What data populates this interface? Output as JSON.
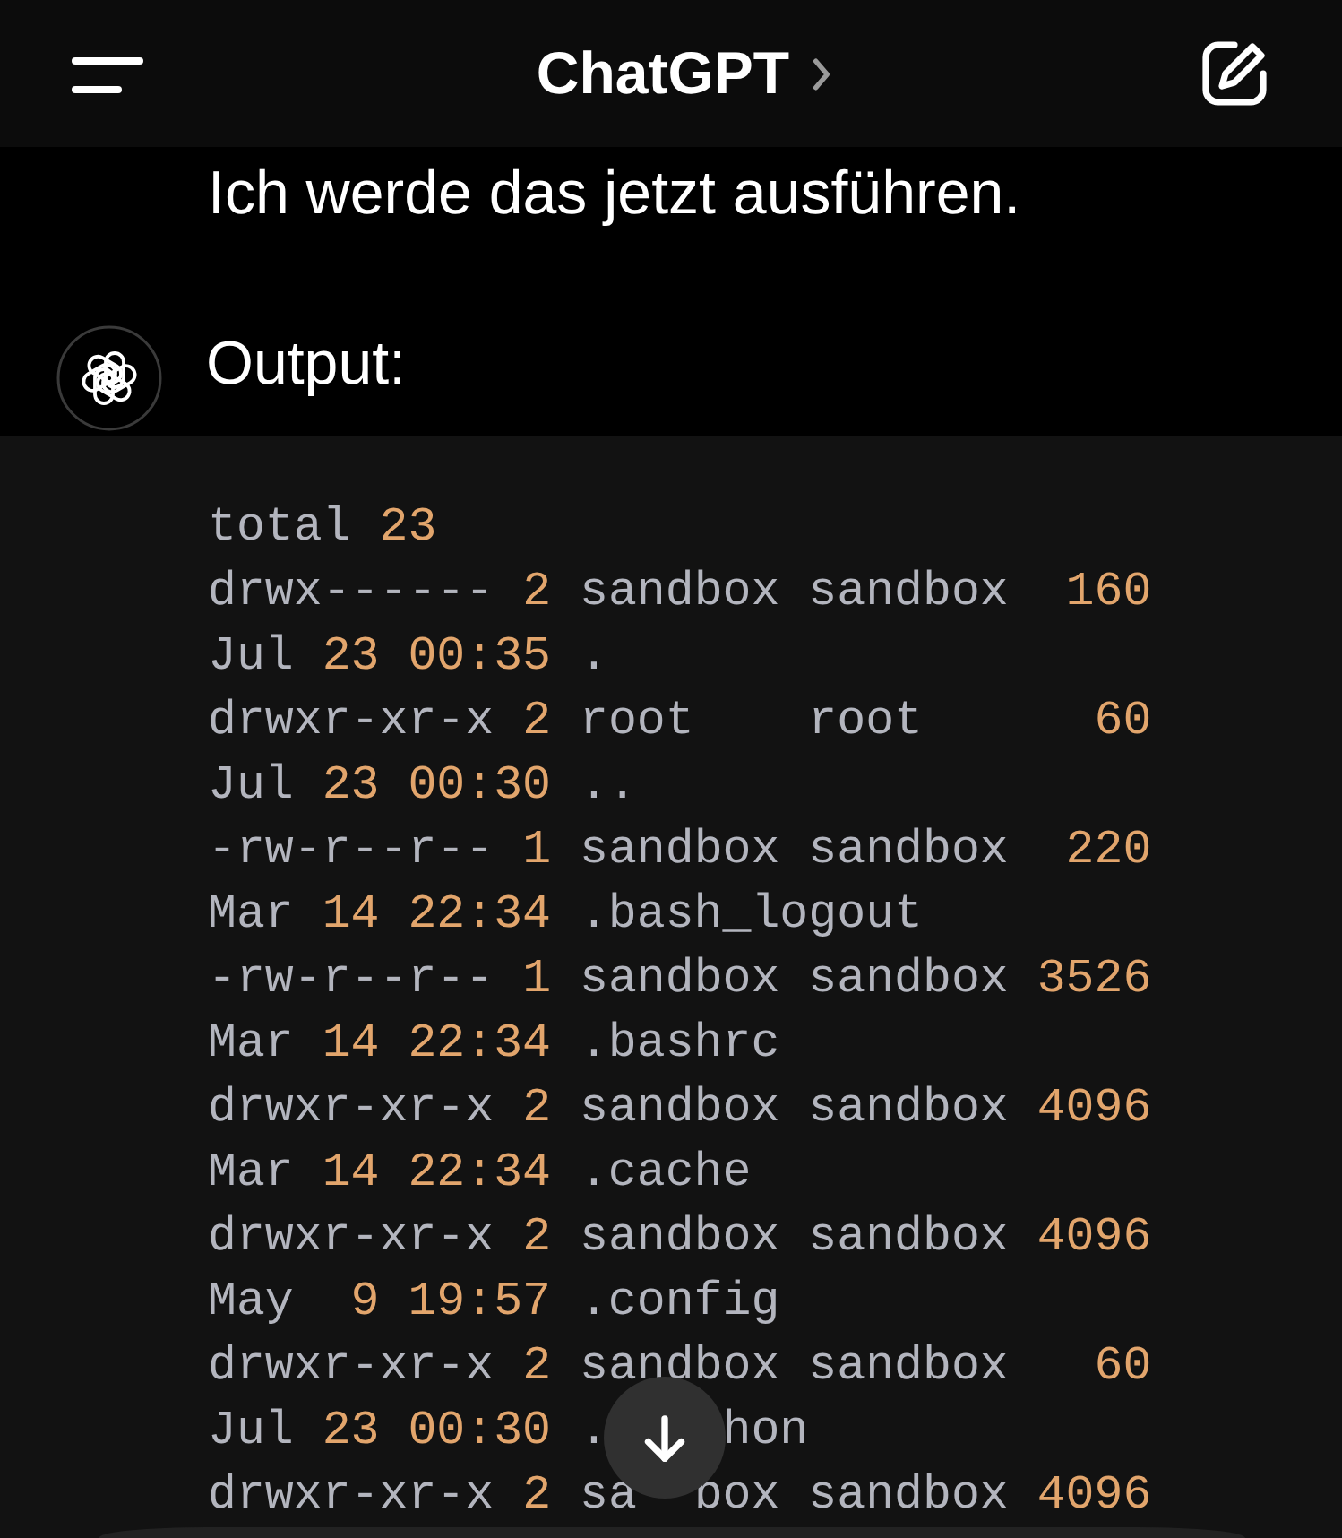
{
  "header": {
    "title": "ChatGPT"
  },
  "messages": [
    {
      "kind": "text",
      "text": "Ich werde das jetzt ausführen.",
      "avatar": false
    },
    {
      "kind": "text",
      "text": "Output:",
      "avatar": true
    },
    {
      "kind": "code",
      "lines": [
        [
          [
            {
              "text": "total ",
              "kind": "plain"
            },
            {
              "text": "23",
              "kind": "number"
            }
          ]
        ],
        [
          [
            {
              "text": "drwx------ ",
              "kind": "plain"
            },
            {
              "text": "2",
              "kind": "number"
            },
            {
              "text": " sandbox sandbox  ",
              "kind": "plain"
            },
            {
              "text": "160",
              "kind": "number"
            }
          ]
        ],
        [
          [
            {
              "text": "Jul ",
              "kind": "plain"
            },
            {
              "text": "23 00:35",
              "kind": "number"
            },
            {
              "text": " .",
              "kind": "plain"
            }
          ]
        ],
        [
          [
            {
              "text": "drwxr-xr-x ",
              "kind": "plain"
            },
            {
              "text": "2",
              "kind": "number"
            },
            {
              "text": " root    root      ",
              "kind": "plain"
            },
            {
              "text": "60",
              "kind": "number"
            }
          ]
        ],
        [
          [
            {
              "text": "Jul ",
              "kind": "plain"
            },
            {
              "text": "23 00:30",
              "kind": "number"
            },
            {
              "text": " ..",
              "kind": "plain"
            }
          ]
        ],
        [
          [
            {
              "text": "-rw-r--r-- ",
              "kind": "plain"
            },
            {
              "text": "1",
              "kind": "number"
            },
            {
              "text": " sandbox sandbox  ",
              "kind": "plain"
            },
            {
              "text": "220",
              "kind": "number"
            }
          ]
        ],
        [
          [
            {
              "text": "Mar ",
              "kind": "plain"
            },
            {
              "text": "14 22:34",
              "kind": "number"
            },
            {
              "text": " .bash_logout",
              "kind": "plain"
            }
          ]
        ],
        [
          [
            {
              "text": "-rw-r--r-- ",
              "kind": "plain"
            },
            {
              "text": "1",
              "kind": "number"
            },
            {
              "text": " sandbox sandbox ",
              "kind": "plain"
            },
            {
              "text": "3526",
              "kind": "number"
            }
          ]
        ],
        [
          [
            {
              "text": "Mar ",
              "kind": "plain"
            },
            {
              "text": "14 22:34",
              "kind": "number"
            },
            {
              "text": " .bashrc",
              "kind": "plain"
            }
          ]
        ],
        [
          [
            {
              "text": "drwxr-xr-x ",
              "kind": "plain"
            },
            {
              "text": "2",
              "kind": "number"
            },
            {
              "text": " sandbox sandbox ",
              "kind": "plain"
            },
            {
              "text": "4096",
              "kind": "number"
            }
          ]
        ],
        [
          [
            {
              "text": "Mar ",
              "kind": "plain"
            },
            {
              "text": "14 22:34",
              "kind": "number"
            },
            {
              "text": " .cache",
              "kind": "plain"
            }
          ]
        ],
        [
          [
            {
              "text": "drwxr-xr-x ",
              "kind": "plain"
            },
            {
              "text": "2",
              "kind": "number"
            },
            {
              "text": " sandbox sandbox ",
              "kind": "plain"
            },
            {
              "text": "4096",
              "kind": "number"
            }
          ]
        ],
        [
          [
            {
              "text": "May  ",
              "kind": "plain"
            },
            {
              "text": "9 19:57",
              "kind": "number"
            },
            {
              "text": " .config",
              "kind": "plain"
            }
          ]
        ],
        [
          [
            {
              "text": "drwxr-xr-x ",
              "kind": "plain"
            },
            {
              "text": "2",
              "kind": "number"
            },
            {
              "text": " sandbox sandbox   ",
              "kind": "plain"
            },
            {
              "text": "60",
              "kind": "number"
            }
          ]
        ],
        [
          [
            {
              "text": "Jul ",
              "kind": "plain"
            },
            {
              "text": "23 00:30",
              "kind": "number"
            },
            {
              "text": " .",
              "kind": "plain"
            }
          ],
          [
            {
              "text": "hon",
              "kind": "plain"
            }
          ]
        ],
        [
          [
            {
              "text": "drwxr-xr-x ",
              "kind": "plain"
            },
            {
              "text": "2",
              "kind": "number"
            },
            {
              "text": " sa  box sandbox ",
              "kind": "plain"
            },
            {
              "text": "4096",
              "kind": "number"
            }
          ]
        ]
      ]
    }
  ]
}
